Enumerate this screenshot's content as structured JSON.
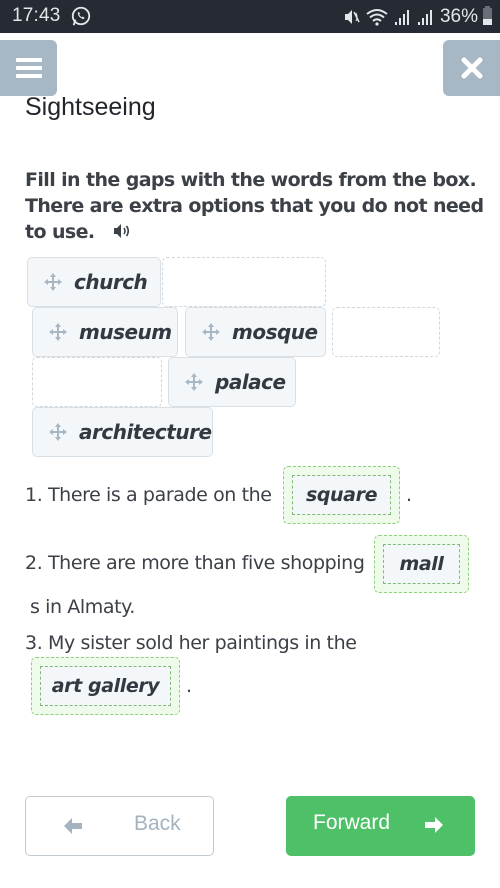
{
  "status_bar": {
    "time": "17:43",
    "battery": "36%",
    "icons": [
      "whatsapp-icon",
      "mute-icon",
      "wifi-icon",
      "signal-icon",
      "signal-icon",
      "battery-icon"
    ]
  },
  "header": {
    "menu_icon": "hamburger-icon",
    "close_icon": "close-icon",
    "title": "Sightseeing"
  },
  "instructions": {
    "text": "Fill in the gaps with the words from the box. There are extra options that you do not need to use.",
    "audio_icon": "speaker-icon"
  },
  "word_bank": {
    "chips": [
      {
        "word": "church",
        "icon": "move-icon"
      },
      {
        "word": "museum",
        "icon": "move-icon"
      },
      {
        "word": "mosque",
        "icon": "move-icon"
      },
      {
        "word": "palace",
        "icon": "move-icon"
      },
      {
        "word": "architecture",
        "icon": "move-icon"
      }
    ],
    "empty_slots": 3
  },
  "sentences": [
    {
      "number": "1.",
      "before": "There is a parade on the",
      "answer": "square",
      "after": "."
    },
    {
      "number": "2.",
      "before": "There are more than five shopping",
      "answer": "mall",
      "after": "s in Almaty."
    },
    {
      "number": "3.",
      "before": "My sister sold her paintings in the",
      "answer": "art gallery",
      "after": "."
    }
  ],
  "footer": {
    "back_label": "Back",
    "forward_label": "Forward"
  },
  "colors": {
    "header_buttons": "#a7b8c4",
    "forward_button": "#4ec168",
    "answer_border": "#8fd07d"
  }
}
